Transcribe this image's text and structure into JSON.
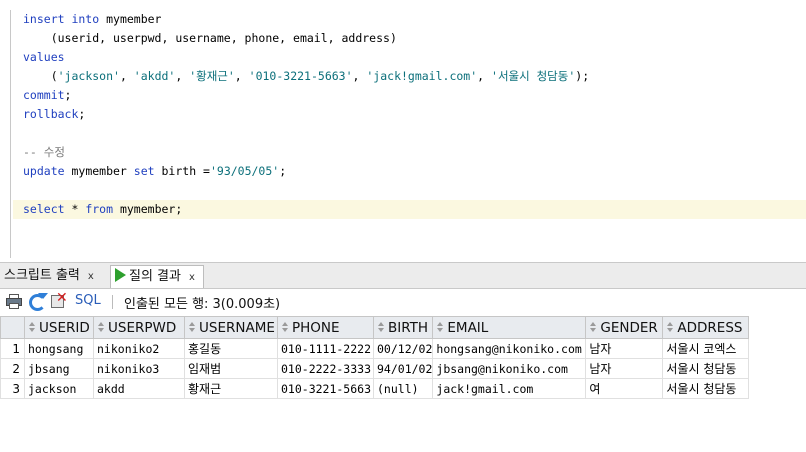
{
  "editor": {
    "lines": [
      [
        {
          "t": "insert into",
          "c": "kw"
        },
        {
          "t": " mymember",
          "c": ""
        }
      ],
      [
        {
          "t": "    (userid, userpwd, username, phone, email, address)",
          "c": ""
        }
      ],
      [
        {
          "t": "values",
          "c": "kw"
        }
      ],
      [
        {
          "t": "    (",
          "c": ""
        },
        {
          "t": "'jackson'",
          "c": "str"
        },
        {
          "t": ", ",
          "c": ""
        },
        {
          "t": "'akdd'",
          "c": "str"
        },
        {
          "t": ", ",
          "c": ""
        },
        {
          "t": "'황재근'",
          "c": "str"
        },
        {
          "t": ", ",
          "c": ""
        },
        {
          "t": "'010-3221-5663'",
          "c": "str"
        },
        {
          "t": ", ",
          "c": ""
        },
        {
          "t": "'jack!gmail.com'",
          "c": "str"
        },
        {
          "t": ", ",
          "c": ""
        },
        {
          "t": "'서울시 청담동'",
          "c": "str"
        },
        {
          "t": ");",
          "c": ""
        }
      ],
      [
        {
          "t": "commit",
          "c": "kw"
        },
        {
          "t": ";",
          "c": ""
        }
      ],
      [
        {
          "t": "rollback",
          "c": "kw"
        },
        {
          "t": ";",
          "c": ""
        }
      ],
      [],
      [
        {
          "t": "-- 수정",
          "c": "cmt"
        }
      ],
      [
        {
          "t": "update",
          "c": "kw"
        },
        {
          "t": " mymember ",
          "c": ""
        },
        {
          "t": "set",
          "c": "kw"
        },
        {
          "t": " birth =",
          "c": ""
        },
        {
          "t": "'93/05/05'",
          "c": "str"
        },
        {
          "t": ";",
          "c": ""
        }
      ],
      [],
      [
        {
          "t": "select",
          "c": "kw"
        },
        {
          "t": " * ",
          "c": ""
        },
        {
          "t": "from",
          "c": "kw"
        },
        {
          "t": " mymember;",
          "c": ""
        }
      ]
    ],
    "current_line": 10
  },
  "tabs": {
    "script_output": "스크립트 출력",
    "query_result": "질의 결과",
    "close": "x"
  },
  "toolbar": {
    "sql_label": "SQL",
    "status": "인출된 모든 행: 3(0.009초)"
  },
  "grid": {
    "columns": [
      "USERID",
      "USERPWD",
      "USERNAME",
      "PHONE",
      "BIRTH",
      "EMAIL",
      "GENDER",
      "ADDRESS"
    ],
    "rows": [
      [
        "1",
        "hongsang",
        "nikoniko2",
        "홍길동",
        "010-1111-2222",
        "00/12/02",
        "hongsang@nikoniko.com",
        "남자",
        "서울시 코엑스"
      ],
      [
        "2",
        "jbsang",
        "nikoniko3",
        "임재범",
        "010-2222-3333",
        "94/01/02",
        "jbsang@nikoniko.com",
        "남자",
        "서울시 청담동"
      ],
      [
        "3",
        "jackson",
        "akdd",
        "황재근",
        "010-3221-5663",
        "(null)",
        "jack!gmail.com",
        "여",
        "서울시 청담동"
      ]
    ]
  }
}
